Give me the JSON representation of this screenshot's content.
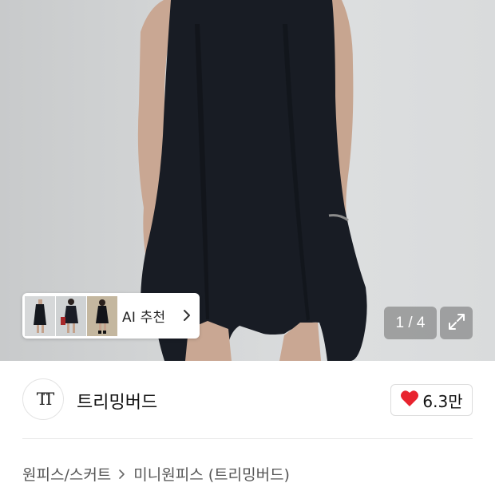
{
  "gallery": {
    "ai_recommend_label": "AI 추천",
    "counter": "1 / 4",
    "icons": {
      "chevron": "chevron-right-icon",
      "expand": "expand-icon"
    }
  },
  "brand": {
    "logo_text": "TT",
    "name": "트리밍버드",
    "like_count": "6.3만",
    "like_color": "#e8232e"
  },
  "breadcrumb": {
    "items": [
      "원피스/스커트",
      "미니원피스 (트리밍버드)"
    ]
  }
}
